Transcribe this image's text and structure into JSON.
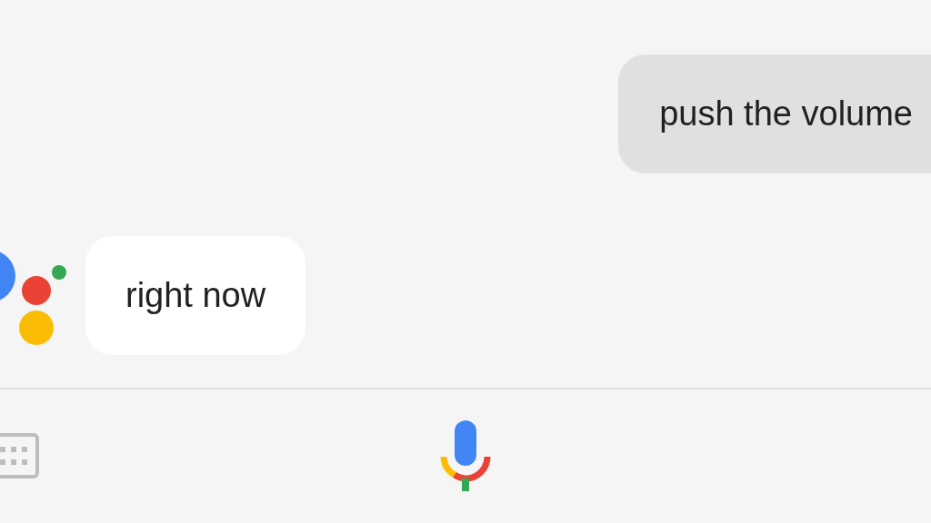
{
  "messages": [
    {
      "kind": "user",
      "text": "push the volume"
    },
    {
      "kind": "assistant",
      "text": "right now"
    }
  ]
}
